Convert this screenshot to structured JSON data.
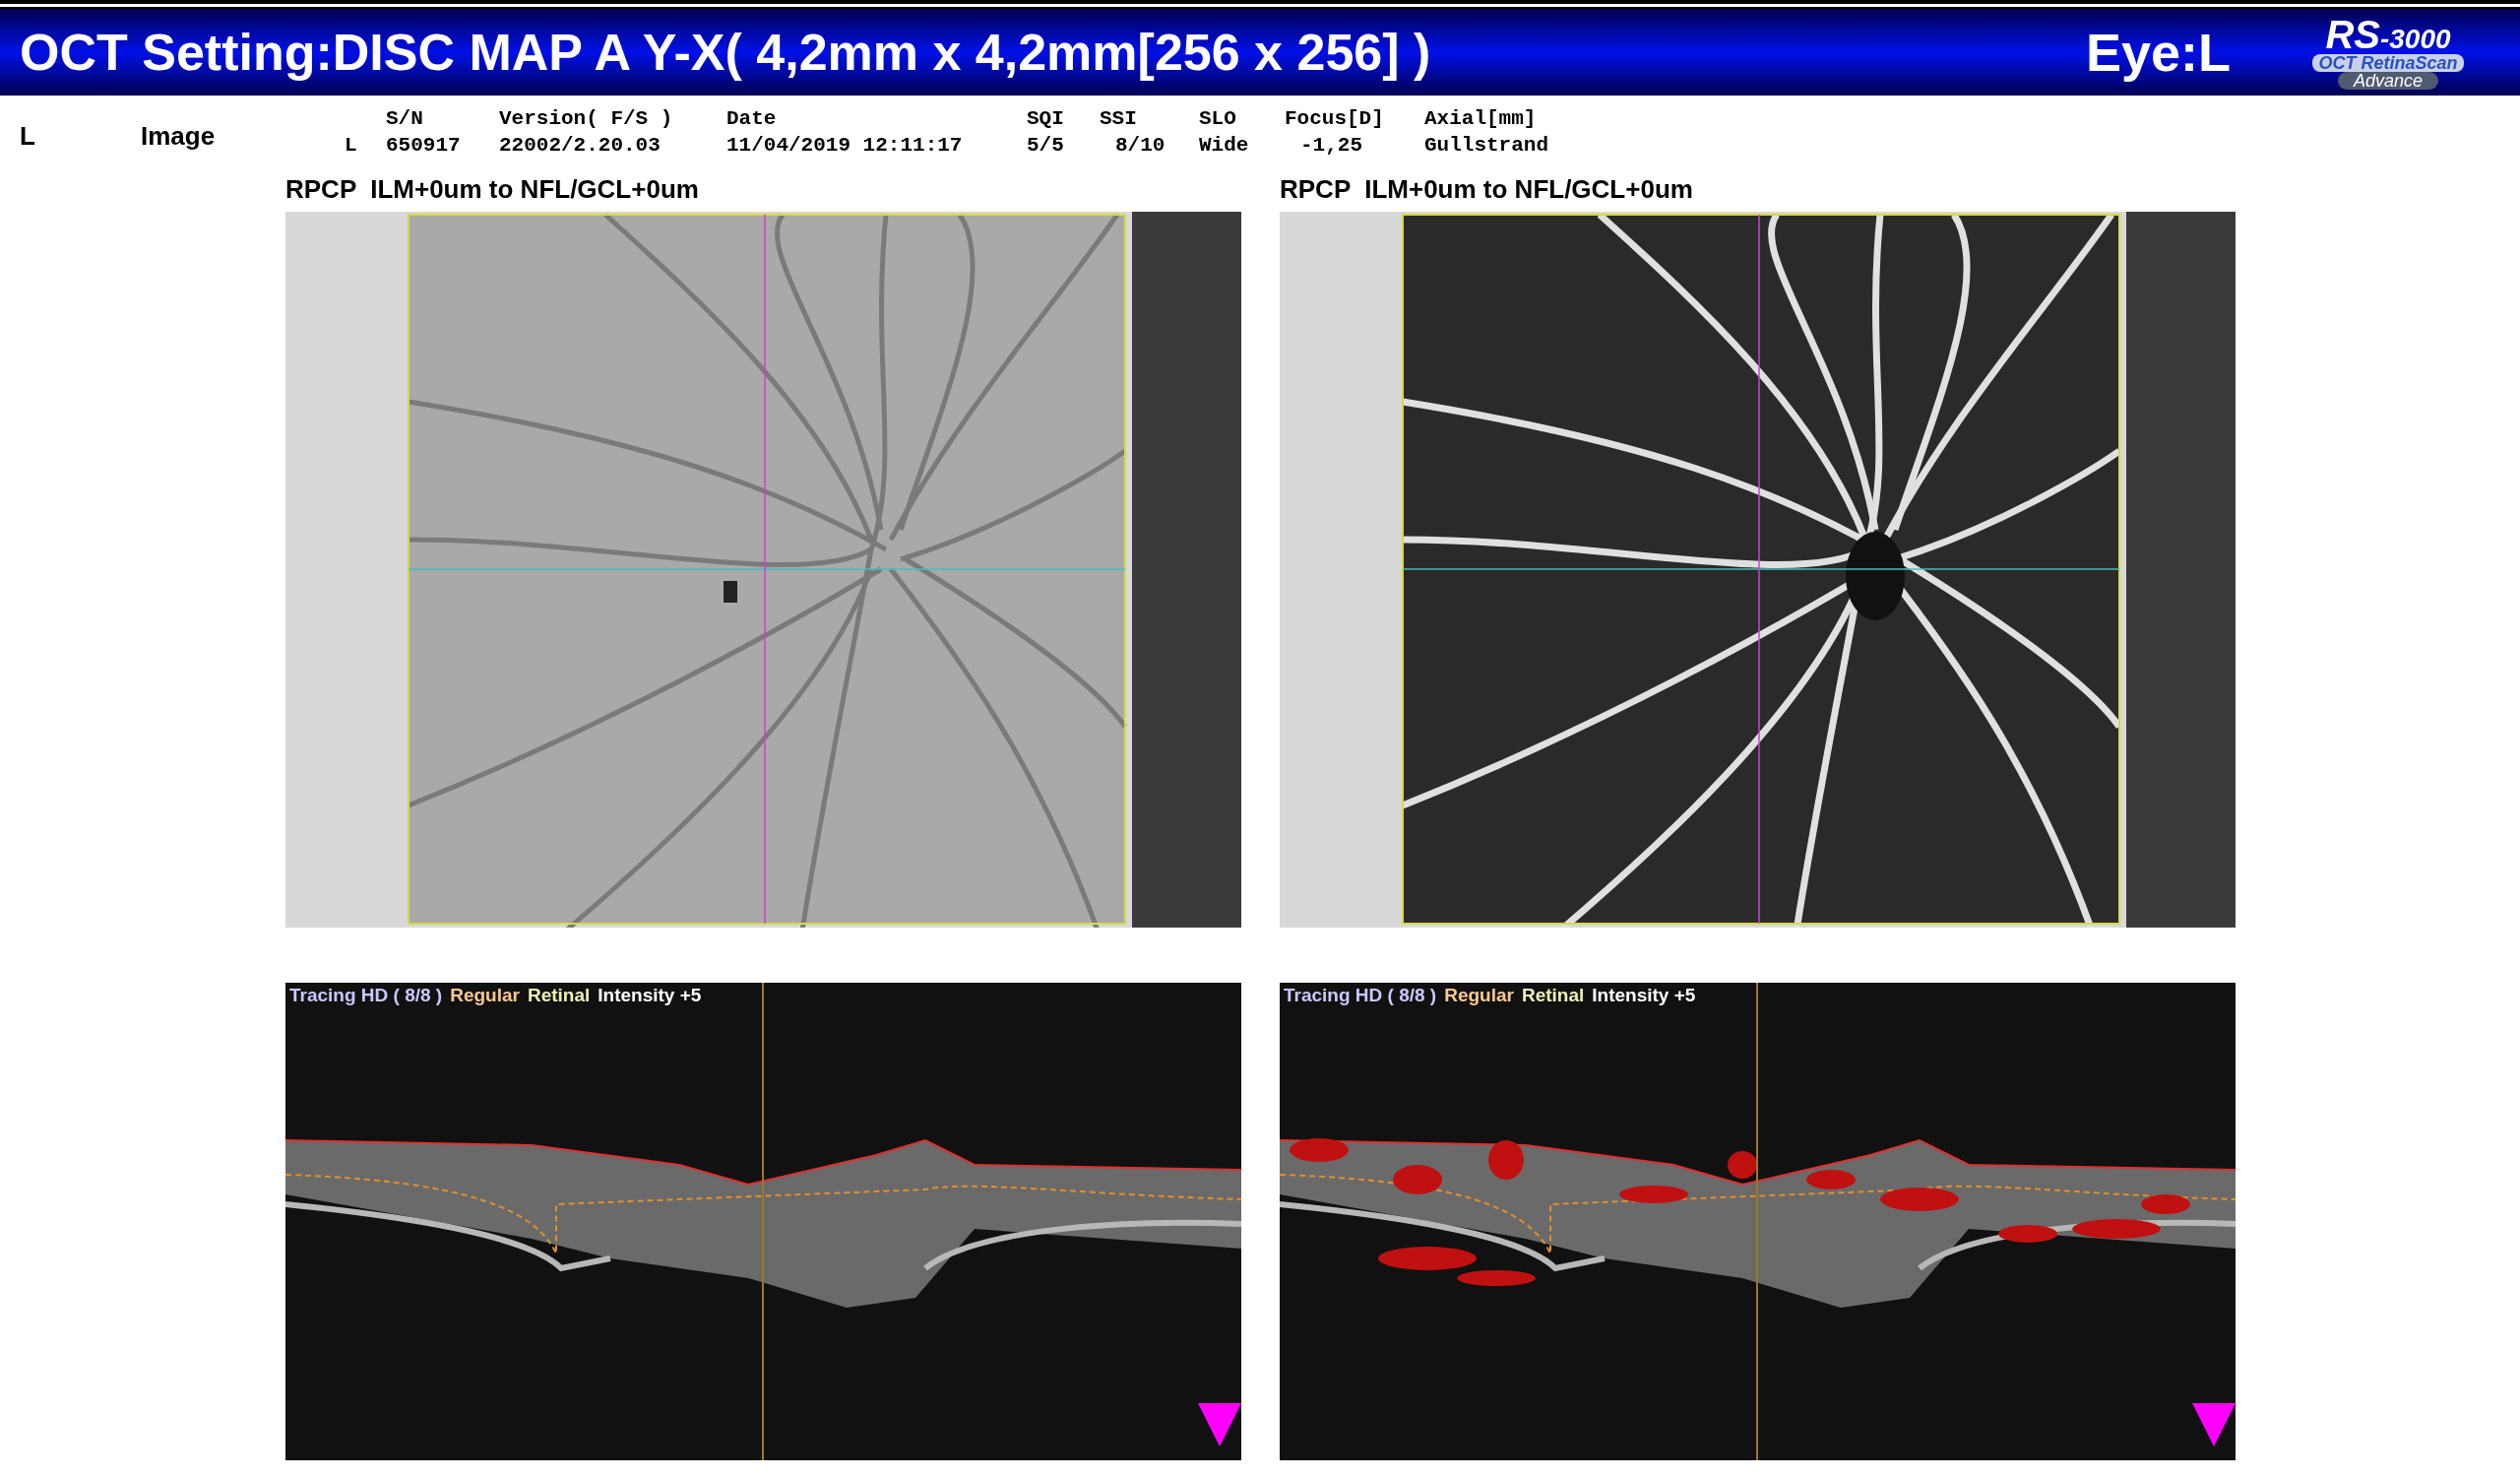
{
  "header": {
    "title": "OCT Setting:DISC MAP A Y-X( 4,2mm x 4,2mm[256 x 256] )",
    "eye": "Eye:L",
    "logo": {
      "brand": "RS",
      "model": "-3000",
      "line1": "OCT RetinaScan",
      "line2": "Advance"
    }
  },
  "info": {
    "eye": "L",
    "label": "Image",
    "row_label": "L",
    "columns": [
      {
        "header": "S/N",
        "value": "650917"
      },
      {
        "header": "Version( F/S )",
        "value": "22002/2.20.03"
      },
      {
        "header": "Date",
        "value": "11/04/2019 12:11:17"
      },
      {
        "header": "SQI",
        "value": "5/5"
      },
      {
        "header": "SSI",
        "value": "8/10"
      },
      {
        "header": "SLO",
        "value": "Wide"
      },
      {
        "header": "Focus[D]",
        "value": "-1,25"
      },
      {
        "header": "Axial[mm]",
        "value": "Gullstrand"
      }
    ]
  },
  "enface": [
    {
      "title": "RPCP  ILM+0um to NFL/GCL+0um",
      "kind": "structure"
    },
    {
      "title": "RPCP  ILM+0um to NFL/GCL+0um",
      "kind": "angio"
    }
  ],
  "bscans": [
    {
      "kind": "plain",
      "labels": [
        {
          "text": "Tracing HD ( 8/8 )",
          "color": "#c8c8ff"
        },
        {
          "text": "Regular",
          "color": "#ffc890"
        },
        {
          "text": "Retinal",
          "color": "#f0f0b4"
        },
        {
          "text": "Intensity +5",
          "color": "#ffffff"
        }
      ]
    },
    {
      "kind": "flow",
      "labels": [
        {
          "text": "Tracing HD ( 8/8 )",
          "color": "#c8c8ff"
        },
        {
          "text": "Regular",
          "color": "#ffc890"
        },
        {
          "text": "Retinal",
          "color": "#f0f0b4"
        },
        {
          "text": "Intensity +5",
          "color": "#ffffff"
        }
      ]
    }
  ]
}
